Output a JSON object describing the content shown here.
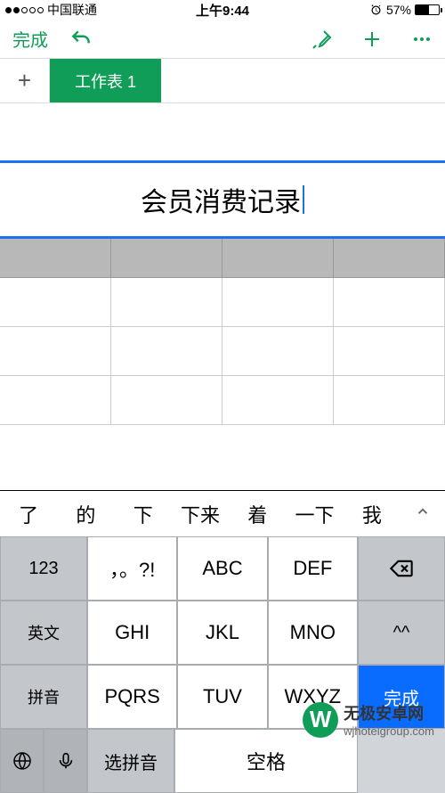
{
  "status": {
    "carrier": "中国联通",
    "time": "上午9:44",
    "battery_pct": "57%"
  },
  "toolbar": {
    "done": "完成"
  },
  "tab": {
    "active": "工作表 1"
  },
  "sheet": {
    "merged_title": "会员消费记录"
  },
  "keyboard": {
    "candidates": [
      "了",
      "的",
      "下",
      "下来",
      "着",
      "一下",
      "我"
    ],
    "keys": {
      "r1": [
        "123",
        "，。?!",
        "ABC",
        "DEF"
      ],
      "r2": [
        "英文",
        "GHI",
        "JKL",
        "MNO",
        "^^"
      ],
      "r3": [
        "拼音",
        "PQRS",
        "TUV",
        "WXYZ"
      ],
      "primary": "完成",
      "select": "选拼音",
      "space": "空格"
    }
  },
  "watermark": {
    "logo": "W",
    "title": "无极安卓网",
    "url": "wjhotelgroup.com"
  }
}
